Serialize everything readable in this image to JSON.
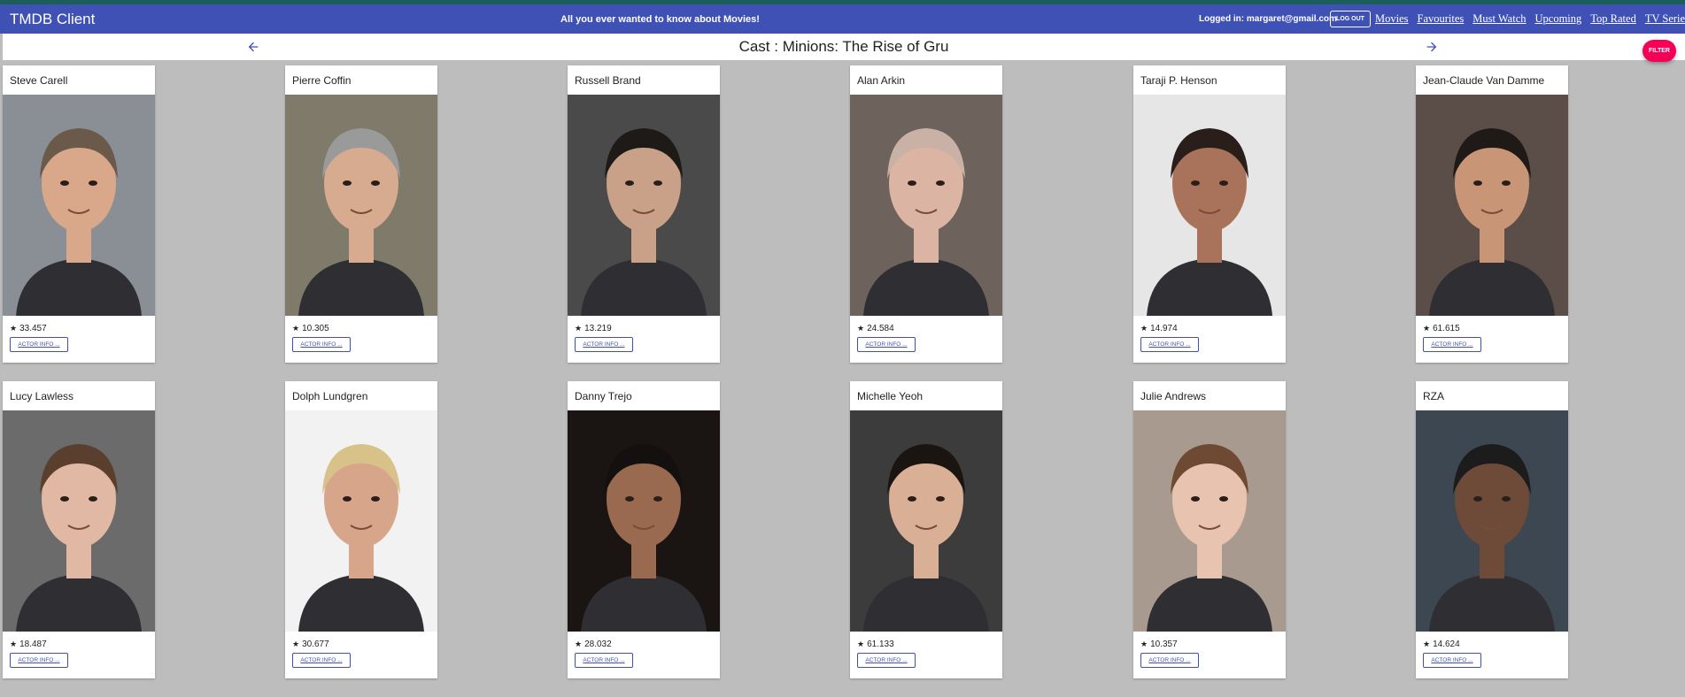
{
  "app": {
    "title": "TMDB Client",
    "tagline": "All you ever wanted to know about Movies!",
    "logged_in": "Logged in: margaret@gmail.com",
    "logout_label": "LOG OUT",
    "nav": [
      "Movies",
      "Favourites",
      "Must Watch",
      "Upcoming",
      "Top Rated",
      "TV Series"
    ]
  },
  "header": {
    "title": "Cast : Minions: The Rise of Gru",
    "prev_icon": "arrow-left-icon",
    "next_icon": "arrow-right-icon"
  },
  "filter_label": "FILTER",
  "cast": [
    {
      "name": "Steve Carell",
      "popularity": "33.457",
      "button": "ACTOR INFO ...",
      "bg": "#8a8f96",
      "skin": "#d9a88a",
      "hair": "#6b5a4a"
    },
    {
      "name": "Pierre Coffin",
      "popularity": "10.305",
      "button": "ACTOR INFO ...",
      "bg": "#7f7a6a",
      "skin": "#d6ab8f",
      "hair": "#9a9a9a"
    },
    {
      "name": "Russell Brand",
      "popularity": "13.219",
      "button": "ACTOR INFO ...",
      "bg": "#4a4a4a",
      "skin": "#c9a088",
      "hair": "#1e1a18"
    },
    {
      "name": "Alan Arkin",
      "popularity": "24.584",
      "button": "ACTOR INFO ...",
      "bg": "#6d625c",
      "skin": "#dcb4a4",
      "hair": "#c9b1a6"
    },
    {
      "name": "Taraji P. Henson",
      "popularity": "14.974",
      "button": "ACTOR INFO ...",
      "bg": "#e6e6e6",
      "skin": "#a8735a",
      "hair": "#2a1e1a"
    },
    {
      "name": "Jean-Claude Van Damme",
      "popularity": "61.615",
      "button": "ACTOR INFO ...",
      "bg": "#5b4d48",
      "skin": "#c89577",
      "hair": "#1f1a18"
    },
    {
      "name": "Lucy Lawless",
      "popularity": "18.487",
      "button": "ACTOR INFO ...",
      "bg": "#6b6b6b",
      "skin": "#e0b8a4",
      "hair": "#5a3f2e"
    },
    {
      "name": "Dolph Lundgren",
      "popularity": "30.677",
      "button": "ACTOR INFO ...",
      "bg": "#f2f2f2",
      "skin": "#d7a58a",
      "hair": "#d8c28a"
    },
    {
      "name": "Danny Trejo",
      "popularity": "28.032",
      "button": "ACTOR INFO ...",
      "bg": "#1a1512",
      "skin": "#9a6a50",
      "hair": "#141010"
    },
    {
      "name": "Michelle Yeoh",
      "popularity": "61.133",
      "button": "ACTOR INFO ...",
      "bg": "#3c3c3c",
      "skin": "#d9b096",
      "hair": "#1b1512"
    },
    {
      "name": "Julie Andrews",
      "popularity": "10.357",
      "button": "ACTOR INFO ...",
      "bg": "#a89a8e",
      "skin": "#e8c4b0",
      "hair": "#6e4a32"
    },
    {
      "name": "RZA",
      "popularity": "14.624",
      "button": "ACTOR INFO ...",
      "bg": "#3d4752",
      "skin": "#6e4a38",
      "hair": "#1c1c1c"
    }
  ]
}
